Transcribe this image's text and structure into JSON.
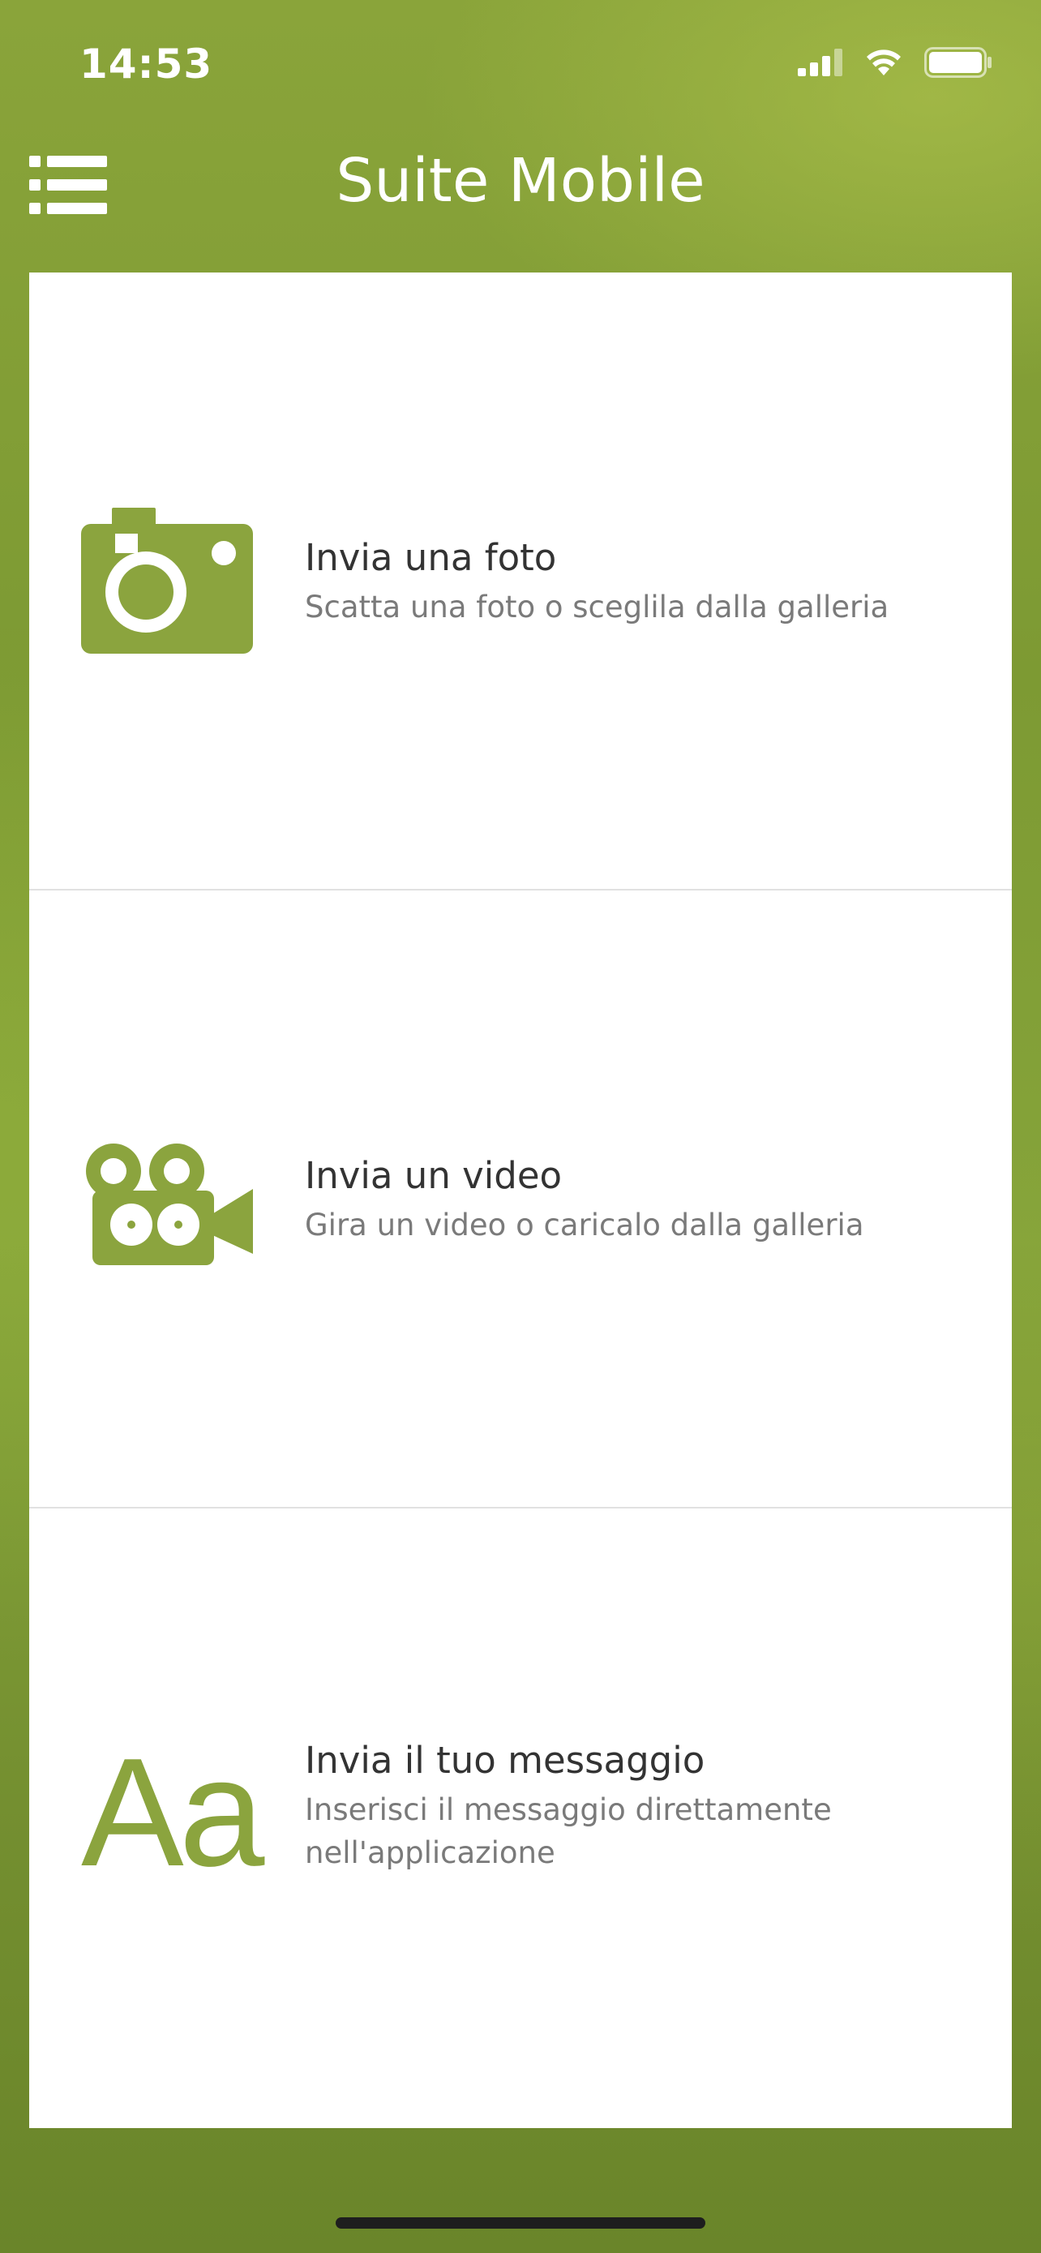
{
  "status_bar": {
    "time": "14:53"
  },
  "nav": {
    "title": "Suite Mobile",
    "menu_icon": "list-menu-icon"
  },
  "colors": {
    "accent": "#8ba43e",
    "background": "#7d9a33",
    "card": "#ffffff",
    "title_text": "#333333",
    "subtitle_text": "#7a7a7a"
  },
  "options": [
    {
      "icon": "camera-icon",
      "title": "Invia una foto",
      "subtitle": "Scatta una foto o sceglila dalla galleria"
    },
    {
      "icon": "video-camera-icon",
      "title": "Invia un video",
      "subtitle": "Gira un video o caricalo dalla galleria"
    },
    {
      "icon": "text-aa-icon",
      "icon_text": "Aa",
      "title": "Invia il tuo messaggio",
      "subtitle": "Inserisci il messaggio direttamente nell'applicazione"
    }
  ]
}
